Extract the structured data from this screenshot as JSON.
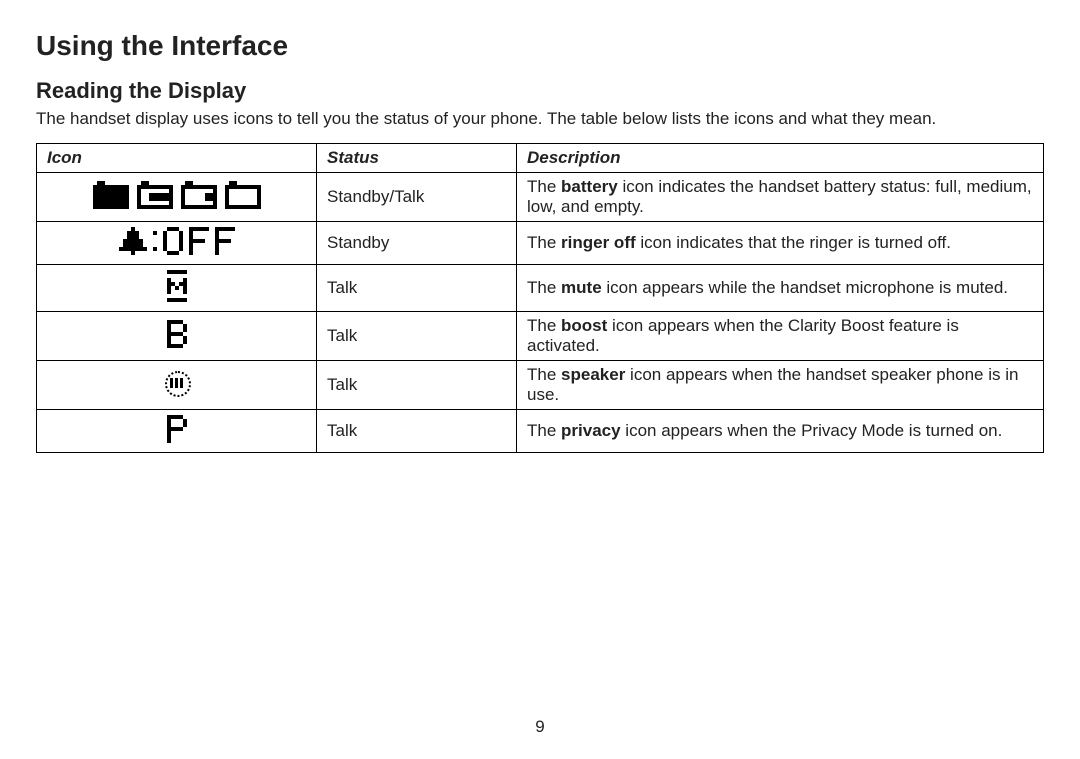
{
  "title": "Using the Interface",
  "section_title": "Reading the Display",
  "intro": "The handset display uses icons to tell you the status of your phone. The table below lists the icons and what they mean.",
  "headers": {
    "icon": "Icon",
    "status": "Status",
    "description": "Description"
  },
  "rows": [
    {
      "icon_name": "battery-levels-icon",
      "status": "Standby/Talk",
      "desc_pre": "The ",
      "desc_bold": "battery",
      "desc_post": " icon indicates the handset battery status: full, medium, low, and empty."
    },
    {
      "icon_name": "ringer-off-icon",
      "status": "Standby",
      "desc_pre": "The ",
      "desc_bold": "ringer off",
      "desc_post": " icon indicates that the ringer is turned off."
    },
    {
      "icon_name": "mute-icon",
      "status": "Talk",
      "desc_pre": "The ",
      "desc_bold": "mute",
      "desc_post": " icon appears while the handset microphone is muted."
    },
    {
      "icon_name": "boost-icon",
      "status": "Talk",
      "desc_pre": "The ",
      "desc_bold": "boost",
      "desc_post": " icon appears when the Clarity Boost feature is activated."
    },
    {
      "icon_name": "speaker-icon",
      "status": "Talk",
      "desc_pre": "The ",
      "desc_bold": "speaker",
      "desc_post": " icon appears when the handset speaker phone is in use."
    },
    {
      "icon_name": "privacy-icon",
      "status": "Talk",
      "desc_pre": "The ",
      "desc_bold": "privacy",
      "desc_post": " icon appears when the Privacy Mode is turned on."
    }
  ],
  "page_number": "9"
}
